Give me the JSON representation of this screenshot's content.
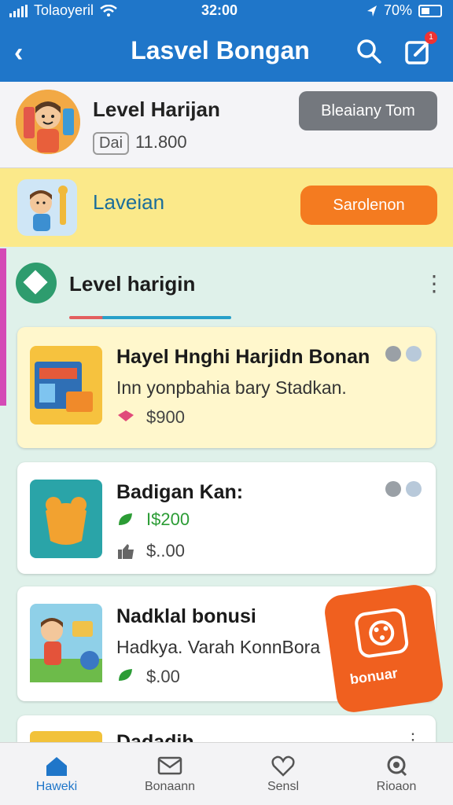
{
  "status": {
    "carrier": "Tolaoyeril",
    "time": "32:00",
    "battery": "70%"
  },
  "header": {
    "title": "Lasvel Bongan",
    "back_icon": "back-chevron-icon",
    "search_icon": "search-icon",
    "edit_icon": "edit-icon",
    "edit_badge": "1"
  },
  "profile": {
    "name": "Level Harijan",
    "badge": "Dai",
    "score": "11.800",
    "button": "Bleaiany Tom"
  },
  "banner": {
    "label": "Laveian",
    "button": "Sarolenon"
  },
  "section": {
    "title": "Level harigin",
    "menu_icon": "more-vertical-icon"
  },
  "cards": [
    {
      "title": "Hayel Hnghi Harjidn Bonan",
      "subtitle": "Inn yonpbahia bary Stadkan.",
      "price": "$900"
    },
    {
      "title": "Badigan Kan:",
      "price_green": "I$200",
      "price2": "$..00"
    },
    {
      "title": "Nadklal bonusi",
      "subtitle": "Hadkya. Varah KonnBora",
      "price": "$.00"
    },
    {
      "title": "Dadadih"
    }
  ],
  "sticker": {
    "label": "bonuar"
  },
  "bottom_nav": [
    {
      "label": "Haweki",
      "icon": "home-icon"
    },
    {
      "label": "Bonaann",
      "icon": "mail-icon"
    },
    {
      "label": "Sensl",
      "icon": "heart-icon"
    },
    {
      "label": "Rioaon",
      "icon": "profile-icon"
    }
  ],
  "colors": {
    "primary": "#1f76c9",
    "orange": "#f47b20",
    "banner": "#fbe98a",
    "green": "#2b9c35"
  }
}
